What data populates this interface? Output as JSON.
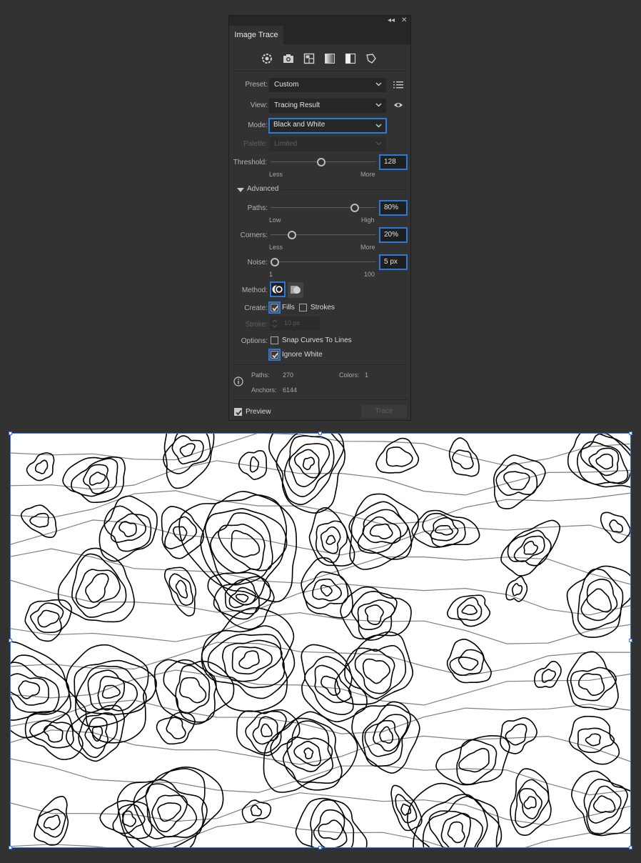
{
  "panel": {
    "title": "Image Trace",
    "topbar": {
      "collapse_glyph": "◂◂",
      "close_glyph": "✕"
    },
    "mode_icons": [
      "auto-color-icon",
      "camera-icon",
      "photo-low-icon",
      "grayscale-icon",
      "black-white-icon",
      "outline-icon"
    ],
    "preset": {
      "label": "Preset:",
      "value": "Custom"
    },
    "view": {
      "label": "View:",
      "value": "Tracing Result"
    },
    "mode": {
      "label": "Mode:",
      "value": "Black and White"
    },
    "palette": {
      "label": "Palette:",
      "value": "Limited"
    },
    "threshold": {
      "label": "Threshold:",
      "value": "128",
      "min_label": "Less",
      "max_label": "More",
      "level": 0.48
    },
    "advanced": {
      "label": "Advanced"
    },
    "paths": {
      "label": "Paths:",
      "value": "80%",
      "min_label": "Low",
      "max_label": "High",
      "level": 0.8
    },
    "corners": {
      "label": "Corners:",
      "value": "20%",
      "min_label": "Less",
      "max_label": "More",
      "level": 0.2
    },
    "noise": {
      "label": "Noise:",
      "value": "5 px",
      "min_label": "1",
      "max_label": "100",
      "level": 0.04
    },
    "method": {
      "label": "Method:"
    },
    "create": {
      "label": "Create:",
      "fills_label": "Fills",
      "fills_checked": true,
      "strokes_label": "Strokes",
      "strokes_checked": false
    },
    "stroke": {
      "label": "Stroke:",
      "value": "10 px"
    },
    "options": {
      "label": "Options:",
      "snap_label": "Snap Curves To Lines",
      "snap_checked": false,
      "ignore_white_label": "Ignore White",
      "ignore_white_checked": true
    },
    "info": {
      "paths_label": "Paths:",
      "paths_value": "270",
      "colors_label": "Colors:",
      "colors_value": "1",
      "anchors_label": "Anchors:",
      "anchors_value": "6144"
    },
    "preview": {
      "label": "Preview",
      "checked": true
    },
    "trace_button": "Trace"
  },
  "colors": {
    "accent": "#2d78d8",
    "selection": "#2f7cf6",
    "panel_bg": "#323232"
  }
}
